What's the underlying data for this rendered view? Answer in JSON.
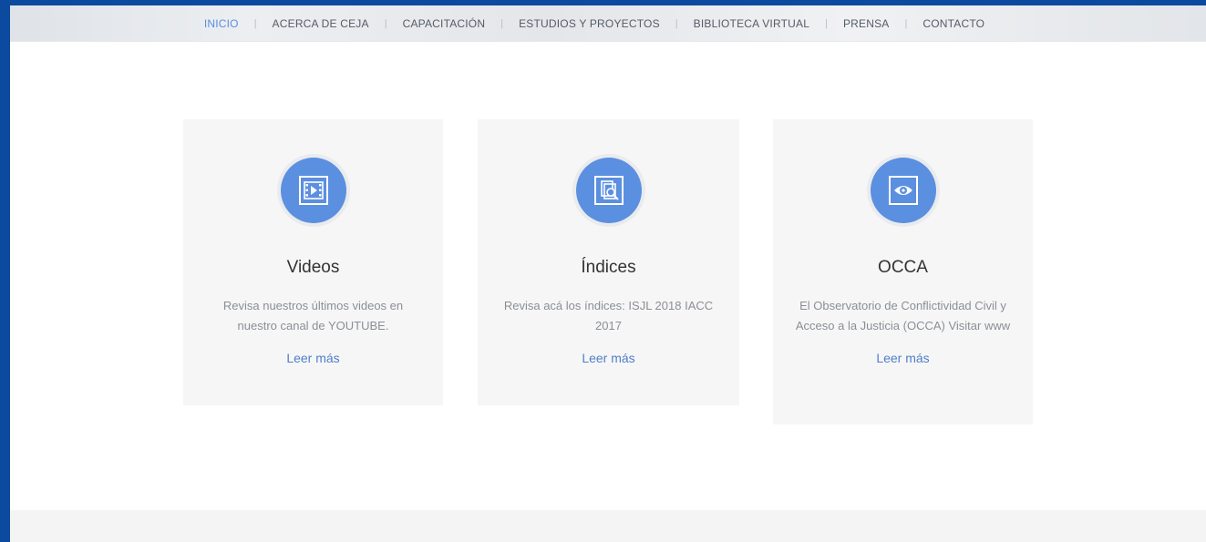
{
  "nav": {
    "items": [
      {
        "label": "INICIO",
        "active": true
      },
      {
        "label": "ACERCA DE CEJA",
        "active": false
      },
      {
        "label": "CAPACITACIÓN",
        "active": false
      },
      {
        "label": "ESTUDIOS Y PROYECTOS",
        "active": false
      },
      {
        "label": "BIBLIOTECA VIRTUAL",
        "active": false
      },
      {
        "label": "PRENSA",
        "active": false
      },
      {
        "label": "CONTACTO",
        "active": false
      }
    ],
    "separator": "|"
  },
  "cards": [
    {
      "icon": "video-icon",
      "title": "Videos",
      "text": "Revisa nuestros últimos videos en nuestro canal de YOUTUBE.",
      "link": "Leer más"
    },
    {
      "icon": "document-search-icon",
      "title": "Índices",
      "text": "Revisa acá los índices: ISJL 2018 IACC 2017",
      "link": "Leer más"
    },
    {
      "icon": "eye-icon",
      "title": "OCCA",
      "text": "El Observatorio de Conflictividad Civil y Acceso a la Justicia  (OCCA)  Visitar www",
      "link": "Leer más"
    }
  ],
  "colors": {
    "accent": "#5b8fe0",
    "frame": "#0b4a9e",
    "card_bg": "#f6f6f6",
    "link": "#4f7fc9"
  }
}
